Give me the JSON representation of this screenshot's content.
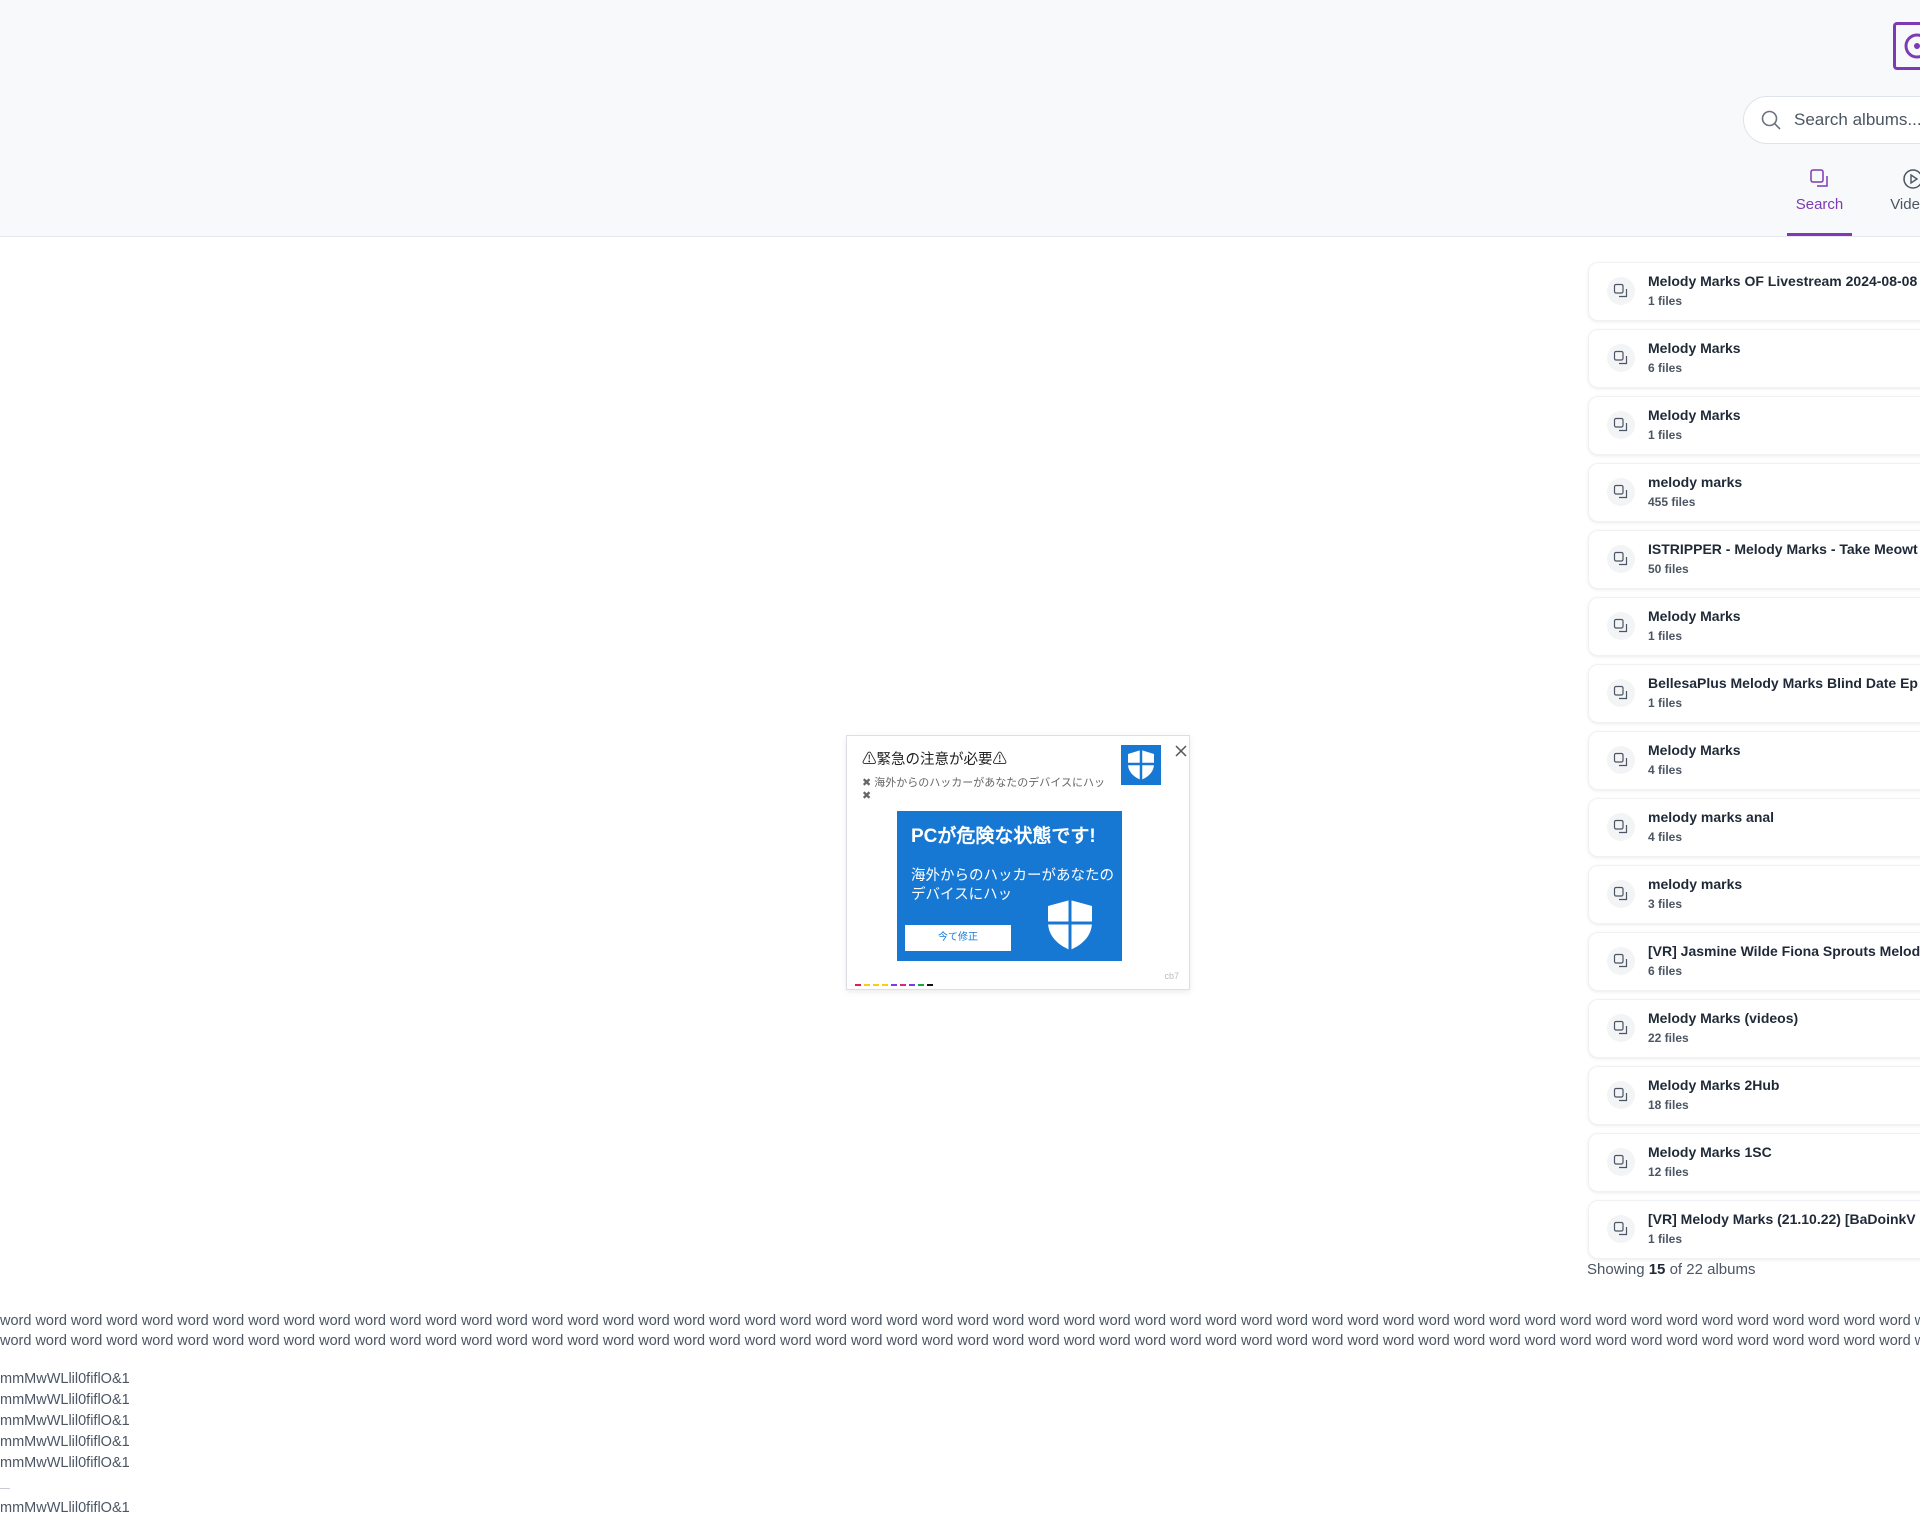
{
  "header": {
    "search_placeholder": "Search albums....",
    "tabs": [
      {
        "label": "Search",
        "active": true,
        "icon": "albums-icon"
      },
      {
        "label": "Videos",
        "active": false,
        "icon": "play-circle-icon"
      }
    ]
  },
  "albums": [
    {
      "title": "Melody Marks OF Livestream 2024-08-08",
      "files": "1 files"
    },
    {
      "title": "Melody Marks",
      "files": "6 files"
    },
    {
      "title": "Melody Marks",
      "files": "1 files"
    },
    {
      "title": "melody marks",
      "files": "455 files"
    },
    {
      "title": "ISTRIPPER - Melody Marks - Take Meowt",
      "files": "50 files"
    },
    {
      "title": "Melody Marks",
      "files": "1 files"
    },
    {
      "title": "BellesaPlus Melody Marks Blind Date Ep",
      "files": "1 files"
    },
    {
      "title": "Melody Marks",
      "files": "4 files"
    },
    {
      "title": "melody marks anal",
      "files": "4 files"
    },
    {
      "title": "melody marks",
      "files": "3 files"
    },
    {
      "title": "[VR] Jasmine Wilde Fiona Sprouts Melod",
      "files": "6 files"
    },
    {
      "title": "Melody Marks (videos)",
      "files": "22 files"
    },
    {
      "title": "Melody Marks 2Hub",
      "files": "18 files"
    },
    {
      "title": "Melody Marks 1SC",
      "files": "12 files"
    },
    {
      "title": "[VR] Melody Marks (21.10.22) [BaDoinkV",
      "files": "1 files"
    }
  ],
  "showing": {
    "prefix": "Showing ",
    "count": "15",
    "suffix": " of 22 albums"
  },
  "filler": {
    "word_line": "word word word word word word word word word word word word word word word word word word word word word word word word word word word word word word word word word word word word word word word word word word word word word word word word word word word word word word word wo",
    "m_line": "mmMwWLlil0fiflO&1"
  },
  "popup": {
    "title": "⚠緊急の注意が必要⚠",
    "message": "✖ 海外からのハッカーがあなたのデバイスにハッ ✖",
    "banner_headline": "PCが危険な状態です!",
    "banner_text": "海外からのハッカーがあなたのデバイスにハッ",
    "banner_button": "今て修正",
    "tag": "cb7",
    "colors": {
      "banner": "#1778d4"
    }
  },
  "colors": {
    "accent": "#7e3ab5",
    "header_bg": "#f8f9fb"
  }
}
